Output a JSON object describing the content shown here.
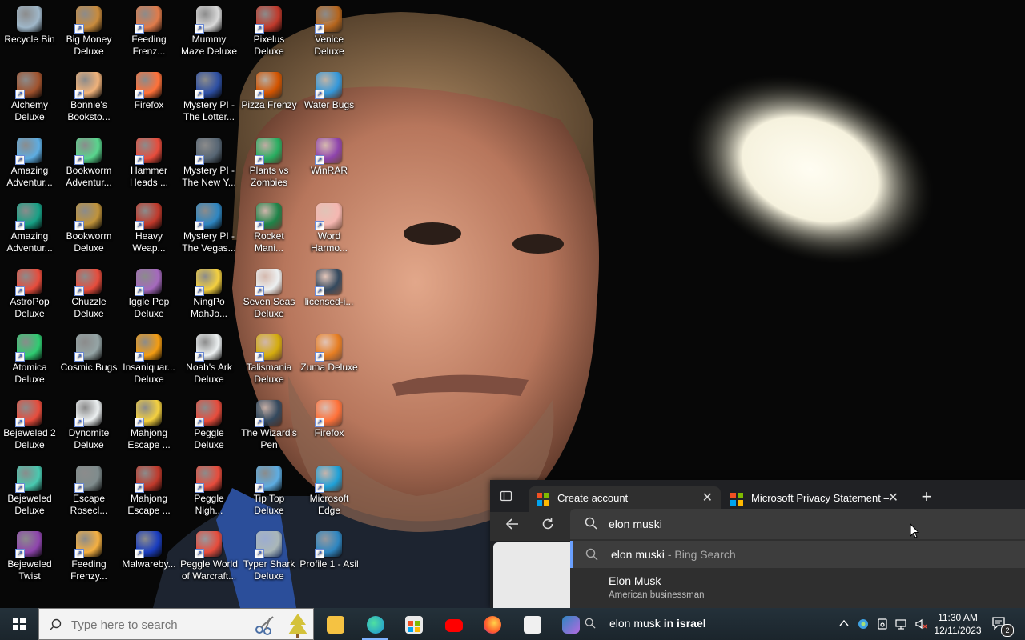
{
  "desktop_icons": [
    {
      "label": "Recycle Bin",
      "icon": "recycle-bin-icon",
      "color": "#9fb7c9"
    },
    {
      "label": "Big Money Deluxe",
      "icon": "money-bag-icon",
      "color": "#c98b3c"
    },
    {
      "label": "Feeding Frenz...",
      "icon": "fish-icon",
      "color": "#e07b4a"
    },
    {
      "label": "Mummy Maze Deluxe",
      "icon": "mummy-icon",
      "color": "#d9d9d9"
    },
    {
      "label": "Pixelus Deluxe",
      "icon": "pixelus-icon",
      "color": "#c0392b"
    },
    {
      "label": "Venice Deluxe",
      "icon": "venice-icon",
      "color": "#b5651d"
    },
    {
      "label": "Alchemy Deluxe",
      "icon": "alchemy-icon",
      "color": "#a0522d"
    },
    {
      "label": "Bonnie's Booksto...",
      "icon": "bonnie-icon",
      "color": "#f0b27a"
    },
    {
      "label": "Firefox",
      "icon": "firefox-icon",
      "color": "#ff7139"
    },
    {
      "label": "Mystery PI - The Lotter...",
      "icon": "mystery-pi-icon",
      "color": "#2d4fa3"
    },
    {
      "label": "Pizza Frenzy",
      "icon": "pizza-icon",
      "color": "#d35400"
    },
    {
      "label": "Water Bugs",
      "icon": "water-bugs-icon",
      "color": "#3498db"
    },
    {
      "label": "Amazing Adventur...",
      "icon": "amazing-adventures-icon",
      "color": "#5dade2"
    },
    {
      "label": "Bookworm Adventur...",
      "icon": "bookworm-icon",
      "color": "#58d68d"
    },
    {
      "label": "Hammer Heads ...",
      "icon": "hammer-heads-icon",
      "color": "#e74c3c"
    },
    {
      "label": "Mystery PI - The New Y...",
      "icon": "mystery-pi-icon",
      "color": "#566573"
    },
    {
      "label": "Plants vs Zombies",
      "icon": "plants-zombies-icon",
      "color": "#27ae60"
    },
    {
      "label": "WinRAR",
      "icon": "winrar-icon",
      "color": "#8e44ad"
    },
    {
      "label": "Amazing Adventur...",
      "icon": "amazing-adventures-icon",
      "color": "#16a085"
    },
    {
      "label": "Bookworm Deluxe",
      "icon": "bookworm-icon",
      "color": "#c0933a"
    },
    {
      "label": "Heavy Weap...",
      "icon": "heavy-weapon-icon",
      "color": "#c0392b"
    },
    {
      "label": "Mystery PI - The Vegas...",
      "icon": "mystery-pi-icon",
      "color": "#2e86c1"
    },
    {
      "label": "Rocket Mani...",
      "icon": "rocket-icon",
      "color": "#1e8449"
    },
    {
      "label": "Word Harmo...",
      "icon": "word-harmony-icon",
      "color": "#f5b7b1"
    },
    {
      "label": "AstroPop Deluxe",
      "icon": "astropop-icon",
      "color": "#e74c3c"
    },
    {
      "label": "Chuzzle Deluxe",
      "icon": "chuzzle-icon",
      "color": "#e74c3c"
    },
    {
      "label": "Iggle Pop Deluxe",
      "icon": "iggle-pop-icon",
      "color": "#a569bd"
    },
    {
      "label": "NingPo MahJo...",
      "icon": "ningpo-icon",
      "color": "#f4d03f"
    },
    {
      "label": "Seven Seas Deluxe",
      "icon": "seven-seas-icon",
      "color": "#ecf0f1"
    },
    {
      "label": "licensed-i...",
      "icon": "image-file-icon",
      "color": "#34495e"
    },
    {
      "label": "Atomica Deluxe",
      "icon": "atomica-icon",
      "color": "#2ecc71"
    },
    {
      "label": "Cosmic Bugs",
      "icon": "cosmic-bugs-icon",
      "color": "#95a5a6"
    },
    {
      "label": "Insaniquar... Deluxe",
      "icon": "insaniquarium-icon",
      "color": "#f39c12"
    },
    {
      "label": "Noah's Ark Deluxe",
      "icon": "noahs-ark-icon",
      "color": "#ecf0f1"
    },
    {
      "label": "Talismania Deluxe",
      "icon": "talismania-icon",
      "color": "#d4ac0d"
    },
    {
      "label": "Zuma Deluxe",
      "icon": "zuma-icon",
      "color": "#e67e22"
    },
    {
      "label": "Bejeweled 2 Deluxe",
      "icon": "bejeweled-icon",
      "color": "#e74c3c"
    },
    {
      "label": "Dynomite Deluxe",
      "icon": "dynomite-icon",
      "color": "#ecf0f1"
    },
    {
      "label": "Mahjong Escape ...",
      "icon": "mahjong-icon",
      "color": "#f4d03f"
    },
    {
      "label": "Peggle Deluxe",
      "icon": "peggle-icon",
      "color": "#e74c3c"
    },
    {
      "label": "The Wizard's Pen",
      "icon": "wizards-pen-icon",
      "color": "#34495e"
    },
    {
      "label": "Firefox",
      "icon": "firefox-icon",
      "color": "#ff7139"
    },
    {
      "label": "Bejeweled Deluxe",
      "icon": "bejeweled-icon",
      "color": "#48c9b0"
    },
    {
      "label": "Escape Rosecl...",
      "icon": "escape-rosecliff-icon",
      "color": "#7f8c8d"
    },
    {
      "label": "Mahjong Escape ...",
      "icon": "mahjong-icon",
      "color": "#c0392b"
    },
    {
      "label": "Peggle Nigh...",
      "icon": "peggle-icon",
      "color": "#e74c3c"
    },
    {
      "label": "Tip Top Deluxe",
      "icon": "tip-top-icon",
      "color": "#5dade2"
    },
    {
      "label": "Microsoft Edge",
      "icon": "edge-icon",
      "color": "#1fa1d8"
    },
    {
      "label": "Bejeweled Twist",
      "icon": "bejeweled-icon",
      "color": "#8e44ad"
    },
    {
      "label": "Feeding Frenzy...",
      "icon": "fish-icon",
      "color": "#f5b041"
    },
    {
      "label": "Malwareby...",
      "icon": "malwarebytes-icon",
      "color": "#1a3dbf"
    },
    {
      "label": "Peggle World of Warcraft...",
      "icon": "peggle-icon",
      "color": "#e74c3c"
    },
    {
      "label": "Typer Shark Deluxe",
      "icon": "typer-shark-icon",
      "color": "#aab7b8"
    },
    {
      "label": "Profile 1 - Asil",
      "icon": "edge-profile-icon",
      "color": "#2e86c1"
    }
  ],
  "browser": {
    "tabs": [
      {
        "title": "Create account",
        "active": true
      },
      {
        "title": "Microsoft Privacy Statement – Microsoft",
        "active": false
      }
    ],
    "address_value": "elon muski",
    "suggestions": {
      "bing_query": "elon muski",
      "bing_suffix": "- Bing Search",
      "entity_title": "Elon Musk",
      "entity_desc": "American businessman",
      "query3_plain": "elon musk",
      "query3_bold": "in israel"
    }
  },
  "taskbar": {
    "search_placeholder": "Type here to search",
    "time": "11:30 AM",
    "date": "12/11/2023",
    "notification_count": "2"
  }
}
